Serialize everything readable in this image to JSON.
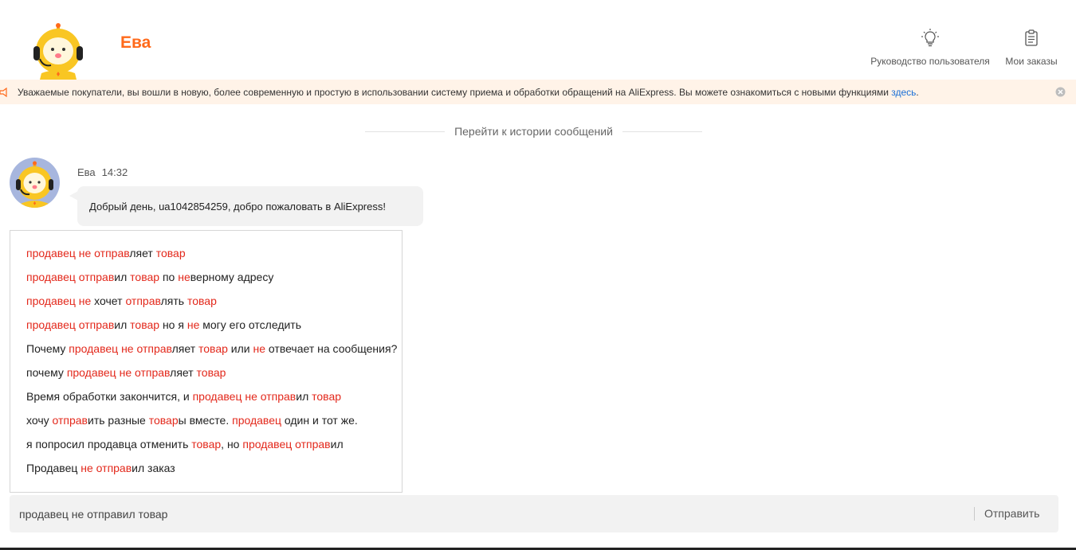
{
  "header": {
    "bot_name": "Ева",
    "user_guide_label": "Руководство пользователя",
    "orders_label": "Мои заказы"
  },
  "notice": {
    "text": "Уважаемые покупатели, вы вошли в новую, более современную и простую в использовании систему приема и обработки обращений на AliExpress. Вы можете ознакомиться с новыми функциями ",
    "link_label": "здесь",
    "tail": "."
  },
  "history_link": "Перейти к истории сообщений",
  "message": {
    "sender": "Ева",
    "time": "14:32",
    "text": "Добрый день, ua1042854259, добро пожаловать в AliExpress!"
  },
  "suggestions": [
    [
      [
        "продавец не отправ",
        true
      ],
      [
        "ляет ",
        false
      ],
      [
        "товар",
        true
      ]
    ],
    [
      [
        "продавец отправ",
        true
      ],
      [
        "ил ",
        false
      ],
      [
        "товар",
        true
      ],
      [
        " по ",
        false
      ],
      [
        "не",
        true
      ],
      [
        "верному адресу",
        false
      ]
    ],
    [
      [
        "продавец не",
        true
      ],
      [
        " хочет ",
        false
      ],
      [
        "отправ",
        true
      ],
      [
        "лять ",
        false
      ],
      [
        "товар",
        true
      ]
    ],
    [
      [
        "продавец отправ",
        true
      ],
      [
        "ил ",
        false
      ],
      [
        "товар",
        true
      ],
      [
        " но я ",
        false
      ],
      [
        "не",
        true
      ],
      [
        " могу его отследить",
        false
      ]
    ],
    [
      [
        "Почему ",
        false
      ],
      [
        "продавец не отправ",
        true
      ],
      [
        "ляет ",
        false
      ],
      [
        "товар",
        true
      ],
      [
        " или ",
        false
      ],
      [
        "не",
        true
      ],
      [
        " отвечает на сообщения?",
        false
      ]
    ],
    [
      [
        "почему ",
        false
      ],
      [
        "продавец не отправ",
        true
      ],
      [
        "ляет ",
        false
      ],
      [
        "товар",
        true
      ]
    ],
    [
      [
        "Время обработки закончится, и ",
        false
      ],
      [
        "продавец не отправ",
        true
      ],
      [
        "ил ",
        false
      ],
      [
        "товар",
        true
      ]
    ],
    [
      [
        "хочу ",
        false
      ],
      [
        "отправ",
        true
      ],
      [
        "ить разные ",
        false
      ],
      [
        "товар",
        true
      ],
      [
        "ы вместе. ",
        false
      ],
      [
        "продавец",
        true
      ],
      [
        " один и тот же.",
        false
      ]
    ],
    [
      [
        "я попросил продавца отменить ",
        false
      ],
      [
        "товар",
        true
      ],
      [
        ", но ",
        false
      ],
      [
        "продавец отправ",
        true
      ],
      [
        "ил",
        false
      ]
    ],
    [
      [
        "Продавец ",
        false
      ],
      [
        "не отправ",
        true
      ],
      [
        "ил заказ",
        false
      ]
    ]
  ],
  "input": {
    "value": "продавец не отправил товар",
    "send_label": "Отправить"
  },
  "colors": {
    "brand_orange": "#ff6a1b",
    "highlight_red": "#e3281b",
    "link_blue": "#1a6fd6",
    "notice_bg": "#fff3e8"
  }
}
